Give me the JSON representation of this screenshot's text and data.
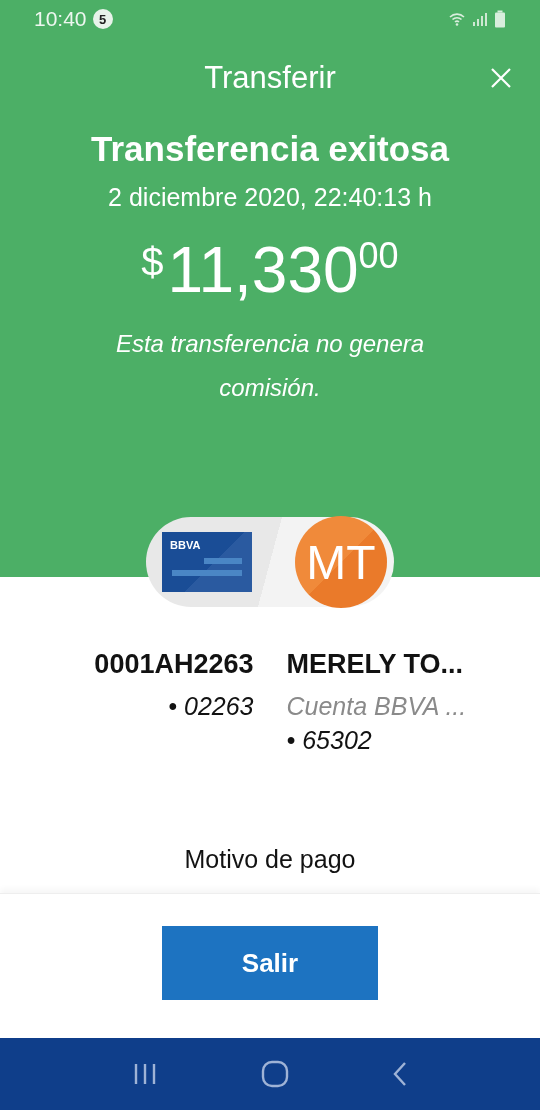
{
  "status_bar": {
    "time": "10:40",
    "notification_count": "5"
  },
  "header": {
    "title": "Transferir"
  },
  "result": {
    "headline": "Transferencia exitosa",
    "datetime": "2 diciembre 2020, 22:40:13 h",
    "currency": "$",
    "amount": "11,330",
    "cents": "00",
    "note": "Esta transferencia no genera comisión."
  },
  "transfer": {
    "source_logo": "BBVA",
    "recipient_initials": "MT"
  },
  "accounts": [
    {
      "name": "0001AH2263",
      "number": "• 02263"
    },
    {
      "name": "MERELY TO...",
      "subtitle": "Cuenta BBVA ...",
      "number": "• 65302"
    }
  ],
  "details": {
    "label": "Motivo de pago"
  },
  "buttons": [
    {
      "label": "Salir"
    }
  ]
}
